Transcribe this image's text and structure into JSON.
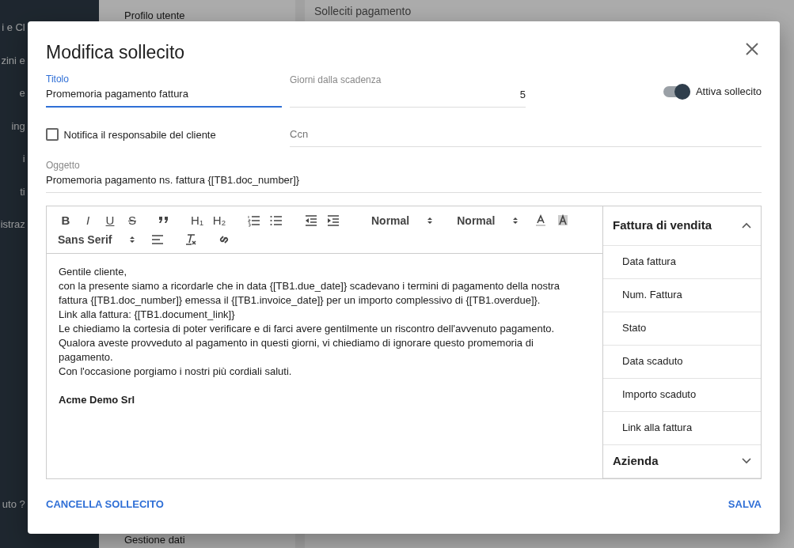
{
  "background": {
    "sidebar_items": [
      "i e Cl",
      "zini e",
      "e",
      "ing",
      "i",
      "ti",
      "istraz",
      "uto ?"
    ],
    "menu_items": [
      "Profilo utente",
      "Gestione dati"
    ],
    "page_subtitle": "Solleciti pagamento"
  },
  "dialog": {
    "title": "Modifica sollecito",
    "fields": [
      {
        "label": "Titolo",
        "value": "Promemoria pagamento fattura",
        "focused": true
      },
      {
        "label": "Giorni dalla scadenza",
        "value": "5",
        "focused": false
      }
    ],
    "toggle": {
      "label": "Attiva sollecito",
      "on": true
    },
    "checkbox": {
      "label": "Notifica il responsabile del cliente",
      "checked": false
    },
    "ccn": {
      "placeholder": "Ccn"
    },
    "subject": {
      "label": "Oggetto",
      "value": "Promemoria pagamento ns. fattura {[TB1.doc_number]}"
    },
    "toolbar_rows": [
      [
        {
          "kind": "text",
          "text": "B"
        },
        {
          "kind": "text",
          "text": "I"
        },
        {
          "kind": "text",
          "text": "U"
        },
        {
          "kind": "text",
          "text": "S"
        },
        {
          "kind": "icon"
        },
        {
          "kind": "text",
          "text": "H₁"
        },
        {
          "kind": "text",
          "text": "H₂"
        },
        {
          "kind": "icon"
        },
        {
          "kind": "icon"
        },
        {
          "kind": "icon"
        },
        {
          "kind": "icon"
        },
        {
          "kind": "select",
          "text": "Normal"
        },
        {
          "kind": "select",
          "text": "Normal"
        },
        {
          "kind": "icon"
        },
        {
          "kind": "icon"
        }
      ],
      [
        {
          "kind": "select",
          "text": "Sans Serif"
        },
        {
          "kind": "icon"
        },
        {
          "kind": "icon"
        },
        {
          "kind": "icon"
        }
      ]
    ],
    "body": [
      {
        "text": "Gentile cliente,",
        "bold": false
      },
      {
        "text": "con la presente siamo a ricordarle che in data {[TB1.due_date]} scadevano i termini di pagamento della nostra fattura {[TB1.doc_number]} emessa il {[TB1.invoice_date]} per un importo complessivo di {[TB1.overdue]}.",
        "bold": false
      },
      {
        "text": "Link alla fattura: {[TB1.document_link]}",
        "bold": false
      },
      {
        "text": "Le chiediamo la cortesia di poter verificare e di farci avere gentilmente un riscontro dell'avvenuto pagamento.",
        "bold": false
      },
      {
        "text": "Qualora aveste provveduto al pagamento in questi giorni, vi chiediamo di ignorare questo promemoria di pagamento.",
        "bold": false
      },
      {
        "text": "Con l'occasione porgiamo i nostri più cordiali saluti.",
        "bold": false
      },
      {
        "text": "Acme Demo Srl",
        "bold": true
      }
    ],
    "variable_groups": [
      {
        "title": "Fattura di vendita",
        "expanded": true,
        "items": [
          "Data fattura",
          "Num. Fattura",
          "Stato",
          "Data scaduto",
          "Importo scaduto",
          "Link alla fattura"
        ]
      },
      {
        "title": "Azienda",
        "expanded": false
      }
    ],
    "actions": [
      "CANCELLA SOLLECITO",
      "SALVA"
    ]
  }
}
